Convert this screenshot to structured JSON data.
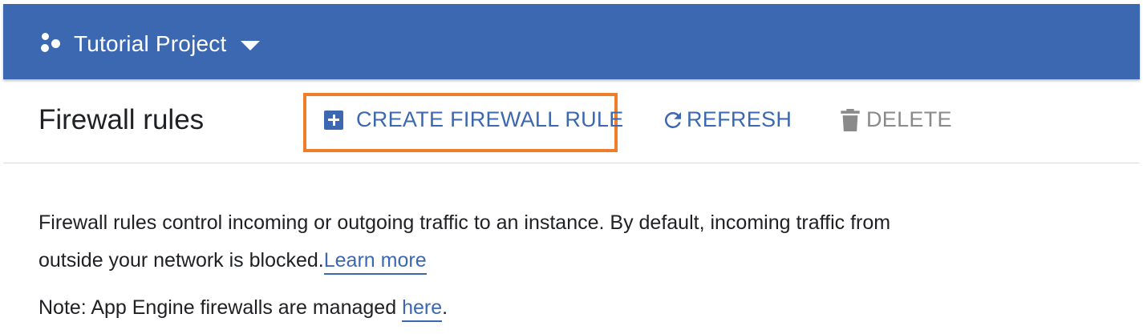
{
  "header": {
    "project_name": "Tutorial Project",
    "project_icon": "project-dots-icon",
    "dropdown_icon": "caret-down-icon",
    "background_color": "#3b68b0"
  },
  "toolbar": {
    "title": "Firewall rules",
    "create_label": "CREATE FIREWALL RULE",
    "create_icon": "add-box-icon",
    "refresh_label": "REFRESH",
    "refresh_icon": "refresh-icon",
    "delete_label": "DELETE",
    "delete_icon": "trash-icon",
    "highlight_color": "#f07d2a"
  },
  "content": {
    "description": "Firewall rules control incoming or outgoing traffic to an instance. By default, incoming traffic from outside your network is blocked.",
    "learn_more_label": "Learn more",
    "note_prefix": "Note: App Engine firewalls are managed ",
    "note_link_label": "here",
    "note_suffix": "."
  }
}
